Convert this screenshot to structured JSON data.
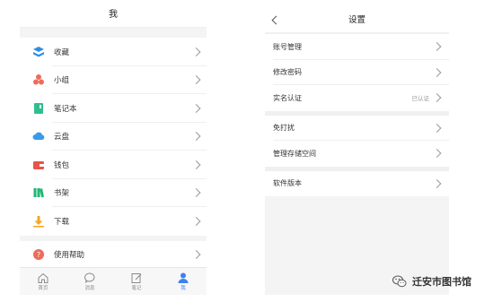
{
  "me_screen": {
    "title": "我",
    "menu": [
      {
        "label": "收藏",
        "icon": "collect-icon"
      },
      {
        "label": "小组",
        "icon": "group-icon"
      },
      {
        "label": "笔记本",
        "icon": "notebook-icon"
      },
      {
        "label": "云盘",
        "icon": "cloud-icon"
      },
      {
        "label": "钱包",
        "icon": "wallet-icon"
      },
      {
        "label": "书架",
        "icon": "bookshelf-icon"
      },
      {
        "label": "下载",
        "icon": "download-icon"
      }
    ],
    "help": {
      "label": "使用帮助",
      "icon": "help-icon"
    },
    "tabs": [
      {
        "label": "首页",
        "icon": "home-icon"
      },
      {
        "label": "消息",
        "icon": "message-icon"
      },
      {
        "label": "笔记",
        "icon": "note-edit-icon"
      },
      {
        "label": "我",
        "icon": "user-icon",
        "active": true
      }
    ]
  },
  "settings_screen": {
    "title": "设置",
    "group1": [
      {
        "label": "账号管理"
      },
      {
        "label": "修改密码"
      },
      {
        "label": "实名认证",
        "value": "已认证"
      }
    ],
    "group2": [
      {
        "label": "免打扰"
      },
      {
        "label": "管理存储空间"
      }
    ],
    "group3": [
      {
        "label": "软件版本"
      }
    ]
  },
  "watermark": {
    "text": "迁安市图书馆",
    "icon": "wechat-icon"
  },
  "colors": {
    "accent": "#3a82f2",
    "gap": "#f4f4f4"
  }
}
